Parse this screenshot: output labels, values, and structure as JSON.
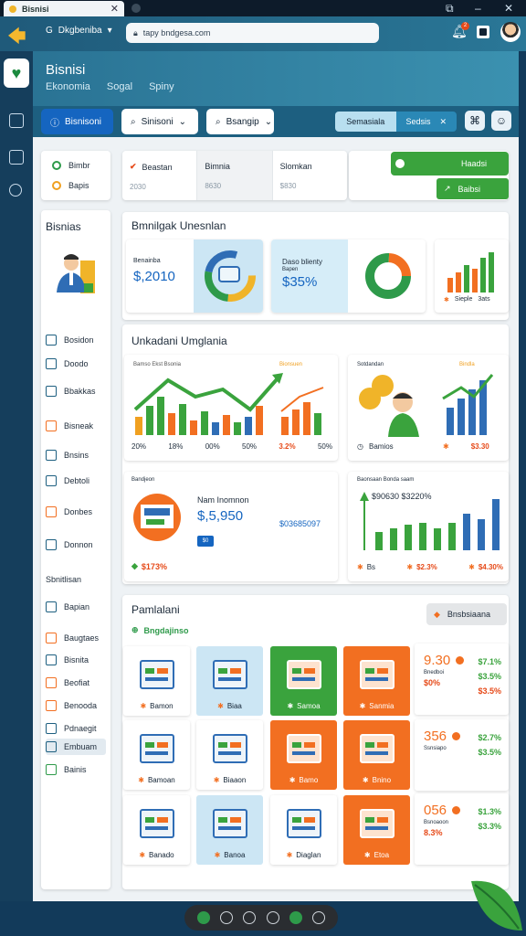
{
  "browser": {
    "tab_title": "Bisnisi",
    "url": "tapy bndgesa.com",
    "account_label": "Dkgbeniba",
    "notification_count": "2"
  },
  "header": {
    "title": "Bisnisi",
    "subtitle": [
      "Ekonomia",
      "Sogal",
      "Spiny"
    ]
  },
  "filters": {
    "primary_button": "Bisnisoni",
    "dropdown_1": "Sinisoni",
    "dropdown_2": "Bsangip",
    "segment_a": "Semasiala",
    "segment_b": "Sedsis"
  },
  "legend_card": {
    "items": [
      {
        "label": "Bimbr",
        "color": "#2e9a4a"
      },
      {
        "label": "Bapis",
        "color": "#f0a020"
      }
    ]
  },
  "kpi": [
    {
      "label": "Beastan",
      "value": "2030"
    },
    {
      "label": "Bimnia",
      "value": "8630"
    },
    {
      "label": "Slomkan",
      "value": "$830"
    }
  ],
  "actions": {
    "green_1": "Haadsi",
    "green_2": "Baibsi"
  },
  "sidebar": {
    "title": "Bisnias",
    "items": [
      {
        "label": "Bosidon",
        "color": "#1d5f80"
      },
      {
        "label": "Doodo",
        "color": "#1d5f80"
      },
      {
        "label": "Bbakkas",
        "color": "#1d5f80"
      },
      {
        "label": "Bisneak",
        "color": "#f26f21"
      },
      {
        "label": "Bnsins",
        "color": "#1d5f80"
      },
      {
        "label": "Debtoli",
        "color": "#1d5f80"
      },
      {
        "label": "Donbes",
        "color": "#f26f21"
      },
      {
        "label": "Donnon",
        "color": "#1d5f80"
      }
    ],
    "section_title": "Sbnitlisan",
    "items2": [
      {
        "label": "Bapian",
        "color": "#1d5f80"
      },
      {
        "label": "Baugtaes",
        "color": "#f26f21"
      },
      {
        "label": "Bisnita",
        "color": "#1d5f80"
      },
      {
        "label": "Beofiat",
        "color": "#f26f21"
      },
      {
        "label": "Benooda",
        "color": "#f26f21"
      },
      {
        "label": "Pdnaegit",
        "color": "#1d5f80"
      },
      {
        "label": "Embuam",
        "color": "#1d5f80"
      },
      {
        "label": "Bainis",
        "color": "#2e9a4a"
      }
    ]
  },
  "section1": {
    "title": "Bmnilgak Unesnlan",
    "card_a": {
      "label": "Benainba",
      "value": "$,2010"
    },
    "card_b": {
      "label": "Daso blienty",
      "sub": "Bapen",
      "value": "$35%"
    },
    "card_c": {
      "label": "Sieple",
      "extra": "3ats"
    }
  },
  "section2": {
    "title": "Unkadani Umglania",
    "c1": {
      "label": "Bamso Ekst Bsonia",
      "tag": "Bionsuen",
      "ticks": [
        "20%",
        "18%",
        "00%",
        "50%",
        "3.2%",
        "50%"
      ]
    },
    "c2": {
      "label": "Sotdandan",
      "tag": "Bindla",
      "foot_left": "Bamios",
      "foot_right": "$3.30"
    },
    "c3": {
      "label": "Bandjeon",
      "name": "Nam Inomnon",
      "value": "$,5,950",
      "badge": "$0",
      "right_value": "$03685097",
      "foot": "$173%"
    },
    "c4": {
      "label": "Baonsaan Bonda saam",
      "value": "$90630 $3220%",
      "foot_a": "Bs",
      "foot_b": "$2.3%",
      "foot_c": "$4.30%"
    }
  },
  "section3": {
    "title": "Pamlalani",
    "link": "Bngdajinso",
    "button": "Bnsbsiaana",
    "tiles": [
      {
        "label": "Bamon",
        "style": "w"
      },
      {
        "label": "Biaa",
        "style": "b"
      },
      {
        "label": "Samoa",
        "style": "g"
      },
      {
        "label": "Sanmia",
        "style": "o"
      },
      {
        "label": "Bamoan",
        "style": "w"
      },
      {
        "label": "Biaaon",
        "style": "w"
      },
      {
        "label": "Bamo",
        "style": "o"
      },
      {
        "label": "Bnino",
        "style": "o"
      },
      {
        "label": "Banado",
        "style": "w"
      },
      {
        "label": "Banoa",
        "style": "b"
      },
      {
        "label": "Diaglan",
        "style": "w"
      },
      {
        "label": "Etoa",
        "style": "o"
      }
    ],
    "stats": [
      {
        "big": "9.30",
        "sub": "Bnedboi",
        "pct": "$0%",
        "r1": "$7.1%",
        "r2": "$3.5%",
        "r3": "$3.5%"
      },
      {
        "big": "356",
        "sub": "Ssnsiapo",
        "pct": "",
        "r1": "$2.7%",
        "r2": "$3.5%",
        "r3": ""
      },
      {
        "big": "056",
        "sub": "Bsnoaoon",
        "pct": "8.3%",
        "r1": "$1.3%",
        "r2": "$3.3%",
        "r3": ""
      }
    ]
  },
  "icons": [
    "back-arrow-icon",
    "search-icon",
    "bell-icon",
    "home-icon",
    "folder-icon",
    "search-icon",
    "leaf-icon"
  ]
}
